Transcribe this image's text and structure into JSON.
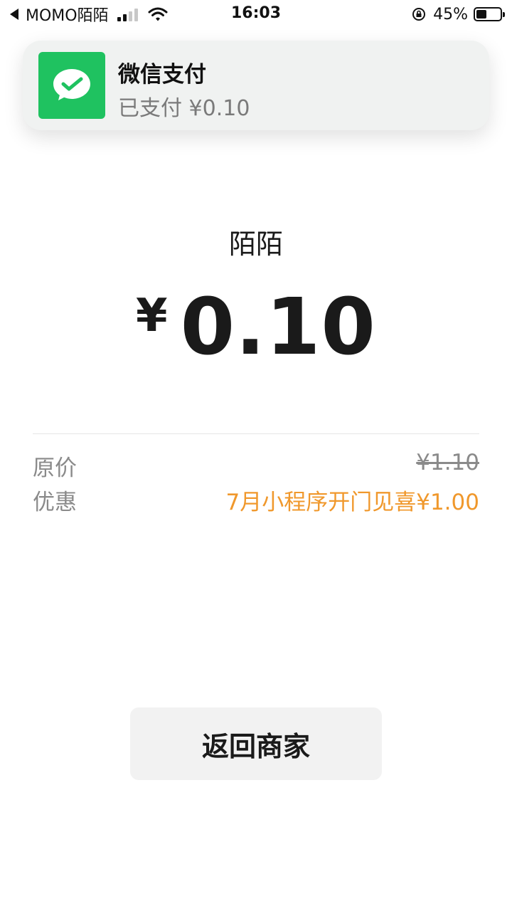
{
  "status_bar": {
    "back_app": "MOMO陌陌",
    "time": "16:03",
    "battery": "45%"
  },
  "notification": {
    "title": "微信支付",
    "body": "已支付 ¥0.10",
    "icon": "wechat-pay-icon",
    "icon_color": "#1fc260"
  },
  "payment": {
    "merchant": "陌陌",
    "currency_symbol": "¥",
    "amount": "0.10"
  },
  "details": {
    "original_label": "原价",
    "original_value": "¥1.10",
    "discount_label": "优惠",
    "discount_value": "7月小程序开门见喜¥1.00"
  },
  "actions": {
    "return_label": "返回商家"
  },
  "colors": {
    "accent_orange": "#f0982c",
    "wechat_green": "#1fc260"
  }
}
